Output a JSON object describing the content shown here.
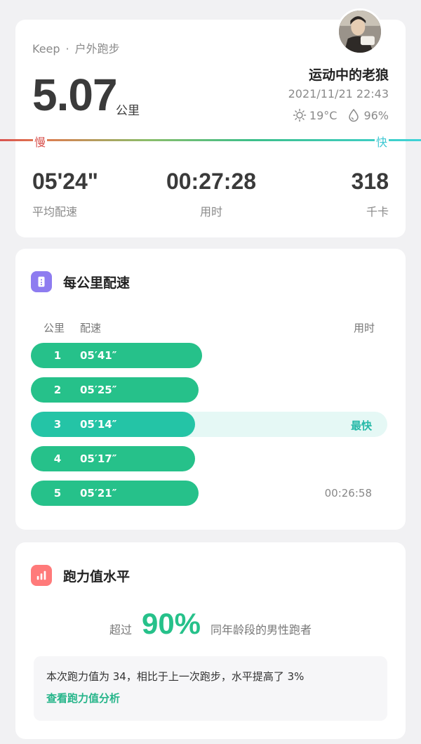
{
  "summary": {
    "app": "Keep",
    "dot": "·",
    "activity": "户外跑步",
    "distance": "5.07",
    "distance_unit": "公里",
    "username": "运动中的老狼",
    "datetime": "2021/11/21 22:43",
    "temperature": "19°C",
    "humidity": "96%",
    "pace_slow_label": "慢",
    "pace_fast_label": "快",
    "stats": {
      "avg_pace": {
        "value": "05'24\"",
        "label": "平均配速"
      },
      "duration": {
        "value": "00:27:28",
        "label": "用时"
      },
      "calories": {
        "value": "318",
        "label": "千卡"
      }
    }
  },
  "splits": {
    "title": "每公里配速",
    "icon": "ruler-icon",
    "columns": {
      "km": "公里",
      "pace": "配速",
      "time": "用时"
    },
    "rows": [
      {
        "km": "1",
        "pace": "05′41″",
        "right": "",
        "fill": 0.48
      },
      {
        "km": "2",
        "pace": "05′25″",
        "right": "",
        "fill": 0.47
      },
      {
        "km": "3",
        "pace": "05′14″",
        "right": "最快",
        "fill": 0.46,
        "fastest": true
      },
      {
        "km": "4",
        "pace": "05′17″",
        "right": "",
        "fill": 0.46
      },
      {
        "km": "5",
        "pace": "05′21″",
        "right": "00:26:58",
        "fill": 0.47
      }
    ]
  },
  "ability": {
    "title": "跑力值水平",
    "icon": "bar-chart-icon",
    "prefix": "超过",
    "percent": "90%",
    "suffix": "同年龄段的男性跑者",
    "description": "本次跑力值为 34，相比于上一次跑步，水平提高了 3%",
    "link": "查看跑力值分析"
  },
  "colors": {
    "accent_green": "#26c18a",
    "fast_teal": "#26b9a8",
    "slow_red": "#d9534f",
    "fast_cyan": "#3fd3d8"
  }
}
